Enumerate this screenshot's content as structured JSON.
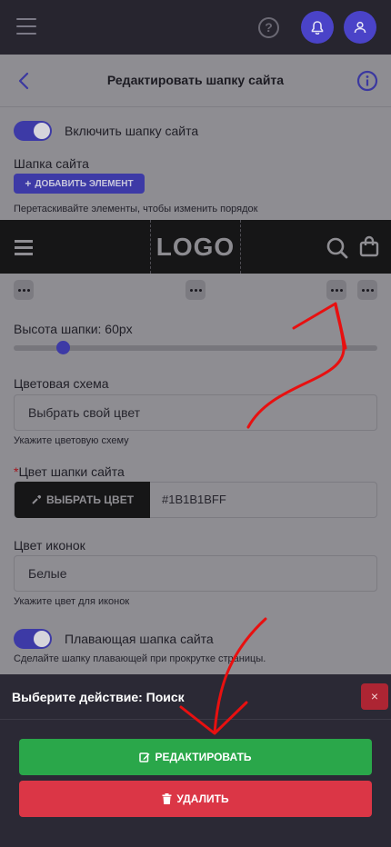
{
  "page": {
    "title": "Редактировать шапку сайта",
    "enable_header_label": "Включить шапку сайта",
    "header_section_label": "Шапка сайта",
    "add_element_label": "ДОБАВИТЬ ЭЛЕМЕНТ",
    "drag_hint": "Перетаскивайте элементы, чтобы изменить порядок",
    "preview_logo": "LOGO",
    "height_label": "Высота шапки: 60px",
    "height_value": 60,
    "color_scheme_label": "Цветовая схема",
    "color_scheme_value": "Выбрать свой цвет",
    "color_scheme_hint": "Укажите цветовую схему",
    "header_color_required": "*",
    "header_color_label": "Цвет шапки сайта",
    "pick_color_label": "ВЫБРАТЬ ЦВЕТ",
    "header_color_value": "#1B1B1BFF",
    "icons_color_label": "Цвет иконок",
    "icons_color_value": "Белые",
    "icons_color_hint": "Укажите цвет для иконок",
    "floating_label": "Плавающая шапка сайта",
    "floating_hint": "Сделайте шапку плавающей при прокрутке страницы."
  },
  "sheet": {
    "title": "Выберите действие: Поиск",
    "close_label": "×",
    "edit_label": "РЕДАКТИРОВАТЬ",
    "delete_label": "УДАЛИТЬ"
  },
  "colors": {
    "accent": "#3d3aa6",
    "edit": "#2aa74a",
    "delete": "#db3646",
    "annotation_arrow": "#e81010"
  }
}
